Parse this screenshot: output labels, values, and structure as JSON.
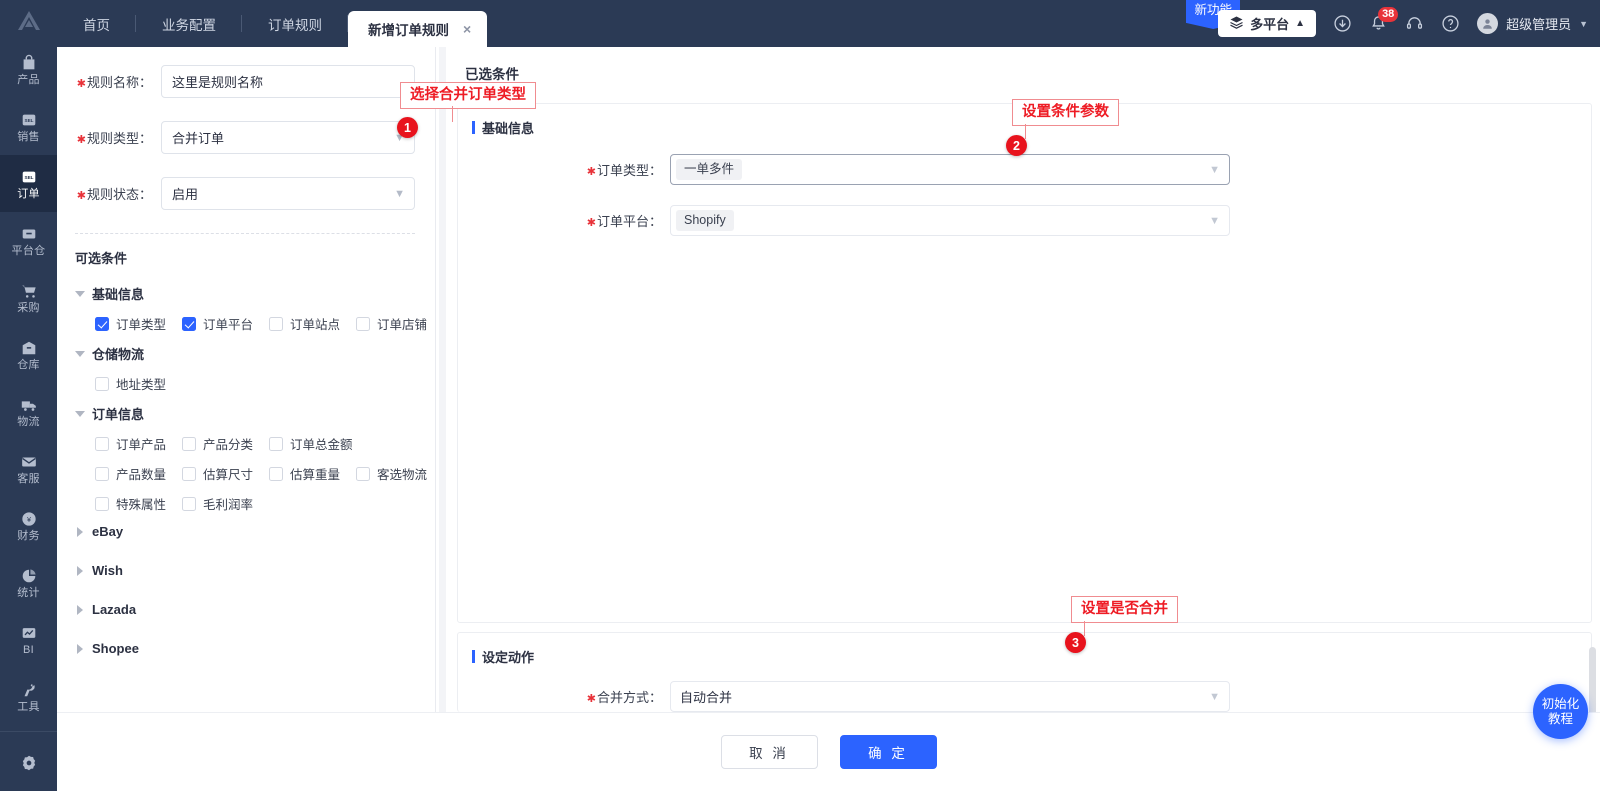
{
  "rail": {
    "logo": "logo-a",
    "items": [
      {
        "label": "产品",
        "icon": "bag-icon",
        "active": false
      },
      {
        "label": "销售",
        "icon": "sell-clipboard-icon",
        "active": false
      },
      {
        "label": "订单",
        "icon": "order-clipboard-icon",
        "active": true
      },
      {
        "label": "平台仓",
        "icon": "box-icon",
        "active": false
      },
      {
        "label": "采购",
        "icon": "cart-icon",
        "active": false
      },
      {
        "label": "仓库",
        "icon": "warehouse-icon",
        "active": false
      },
      {
        "label": "物流",
        "icon": "truck-icon",
        "active": false
      },
      {
        "label": "客服",
        "icon": "mail-icon",
        "active": false
      },
      {
        "label": "财务",
        "icon": "coin-icon",
        "active": false
      },
      {
        "label": "统计",
        "icon": "pie-chart-icon",
        "active": false
      },
      {
        "label": "BI",
        "icon": "bi-chart-icon",
        "active": false
      },
      {
        "label": "工具",
        "icon": "wrench-icon",
        "active": false
      }
    ],
    "settings_icon": "gear-icon"
  },
  "topbar": {
    "tabs": [
      {
        "label": "首页",
        "active": false
      },
      {
        "label": "业务配置",
        "active": false
      },
      {
        "label": "订单规则",
        "active": false
      },
      {
        "label": "新增订单规则",
        "active": true,
        "closable": true
      }
    ],
    "close_glyph": "×",
    "new_feature_label": "新功能",
    "platform_switch": {
      "label": "多平台",
      "icon": "layers-icon",
      "caret": "caret-up"
    },
    "icons": [
      {
        "name": "download-icon"
      },
      {
        "name": "bell-icon",
        "badge": "38"
      },
      {
        "name": "headset-icon"
      },
      {
        "name": "help-icon"
      }
    ],
    "user": {
      "name": "超级管理员",
      "avatar_icon": "user-avatar-icon",
      "caret": "caret-down"
    }
  },
  "form": {
    "fields": [
      {
        "label": "规则名称：",
        "value": "这里是规则名称",
        "type": "text",
        "required": true
      },
      {
        "label": "规则类型：",
        "value": "合并订单",
        "type": "select",
        "required": true
      },
      {
        "label": "规则状态：",
        "value": "启用",
        "type": "select",
        "required": true
      }
    ],
    "optional_title": "可选条件",
    "groups": [
      {
        "name": "基础信息",
        "expanded": true,
        "rows": [
          [
            {
              "label": "订单类型",
              "checked": true
            },
            {
              "label": "订单平台",
              "checked": true
            },
            {
              "label": "订单站点",
              "checked": false
            },
            {
              "label": "订单店铺",
              "checked": false
            }
          ]
        ]
      },
      {
        "name": "仓储物流",
        "expanded": true,
        "rows": [
          [
            {
              "label": "地址类型",
              "checked": false
            }
          ]
        ]
      },
      {
        "name": "订单信息",
        "expanded": true,
        "rows": [
          [
            {
              "label": "订单产品",
              "checked": false
            },
            {
              "label": "产品分类",
              "checked": false
            },
            {
              "label": "订单总金额",
              "checked": false
            }
          ],
          [
            {
              "label": "产品数量",
              "checked": false
            },
            {
              "label": "估算尺寸",
              "checked": false
            },
            {
              "label": "估算重量",
              "checked": false
            },
            {
              "label": "客选物流",
              "checked": false
            }
          ],
          [
            {
              "label": "特殊属性",
              "checked": false
            },
            {
              "label": "毛利润率",
              "checked": false
            }
          ]
        ]
      }
    ],
    "platforms": [
      {
        "label": "eBay",
        "expanded": false
      },
      {
        "label": "Wish",
        "expanded": false
      },
      {
        "label": "Lazada",
        "expanded": false
      },
      {
        "label": "Shopee",
        "expanded": false
      }
    ]
  },
  "right": {
    "title": "已选条件",
    "conditions_card": {
      "title": "基础信息",
      "fields": [
        {
          "label": "订单类型：",
          "value": "一单多件",
          "required": true,
          "style": "tag",
          "focused": true
        },
        {
          "label": "订单平台：",
          "value": "Shopify",
          "required": true,
          "style": "tag",
          "focused": false
        }
      ]
    },
    "action_card": {
      "title": "设定动作",
      "fields": [
        {
          "label": "合并方式：",
          "value": "自动合并",
          "required": true,
          "style": "plain",
          "focused": false
        }
      ]
    }
  },
  "annotations": [
    {
      "id": "1",
      "text": "选择合并订单类型"
    },
    {
      "id": "2",
      "text": "设置条件参数"
    },
    {
      "id": "3",
      "text": "设置是否合并"
    }
  ],
  "footer": {
    "cancel_label": "取 消",
    "confirm_label": "确 定"
  },
  "fab": {
    "line1": "初始化",
    "line2": "教程"
  },
  "colors": {
    "rail_bg": "#2b3a55",
    "rail_active": "#1f2c44",
    "primary": "#2c63ff",
    "annotation_red": "#ee1c25",
    "badge_red": "#e8333a"
  }
}
